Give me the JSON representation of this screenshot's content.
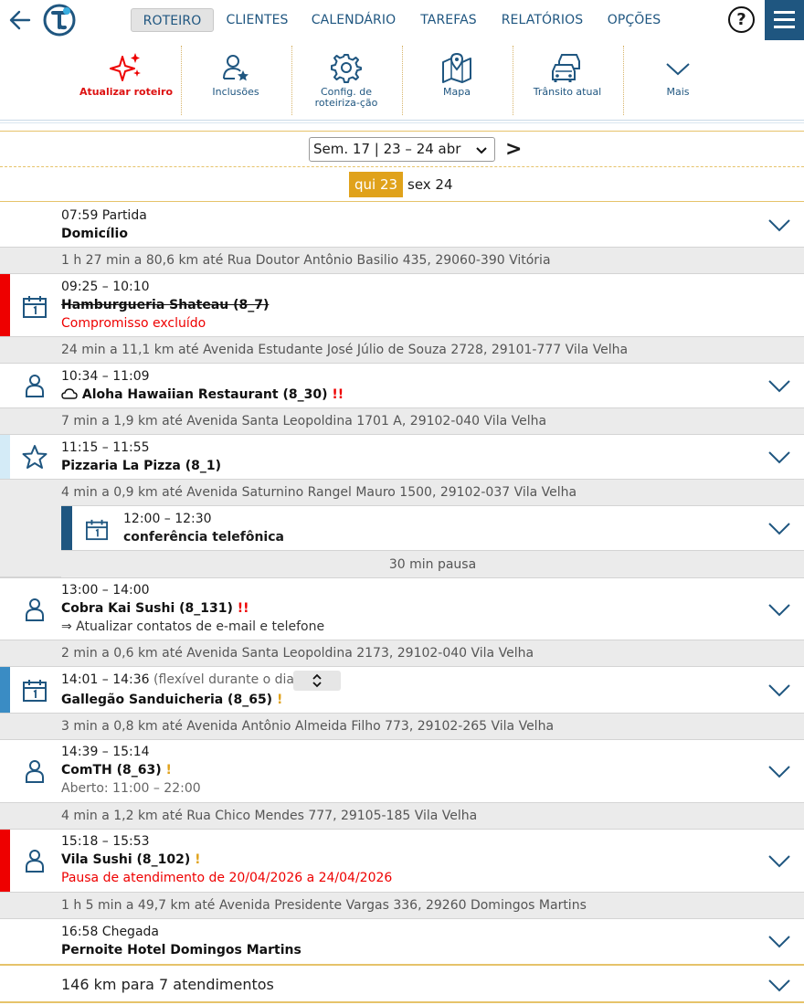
{
  "nav": {
    "tabs": [
      "ROTEIRO",
      "CLIENTES",
      "CALENDÁRIO",
      "TAREFAS",
      "RELATÓRIOS",
      "OPÇÕES"
    ],
    "active_tab": "ROTEIRO",
    "help_label": "?"
  },
  "toolbar": {
    "update_route": "Atualizar roteiro",
    "inclusions": "Inclusões",
    "routing_config": "Config. de roteiriza-ção",
    "map": "Mapa",
    "traffic": "Trânsito atual",
    "more": "Mais"
  },
  "week": {
    "selected": "Sem. 17 | 23 – 24 abr",
    "next_label": ">",
    "days": [
      "qui 23",
      "sex 24"
    ],
    "active_day": "qui 23"
  },
  "route": {
    "start": {
      "time": "07:59 Partida",
      "name": "Domicílio"
    },
    "travel1": "1 h 27 min a 80,6 km até Rua Doutor Antônio Basilio 435, 29060-390 Vitória",
    "stop1": {
      "time": "09:25 – 10:10",
      "name": "Hamburgueria Shateau (8_7)",
      "note": "Compromisso excluído"
    },
    "travel2": "24 min a 11,1 km até Avenida Estudante José Júlio de Souza 2728, 29101-777 Vila Velha",
    "stop2": {
      "time": "10:34 – 11:09",
      "name": "Aloha Hawaiian Restaurant (8_30)",
      "flag": "!!"
    },
    "travel3": "7 min a 1,9 km até Avenida Santa Leopoldina 1701 A, 29102-040 Vila Velha",
    "stop3": {
      "time": "11:15 – 11:55",
      "name": "Pizzaria La Pizza (8_1)"
    },
    "travel4": "4 min a 0,9 km até Avenida Saturnino Rangel Mauro 1500, 29102-037 Vila Velha",
    "appointment": {
      "time": "12:00 – 12:30",
      "name": "conferência telefônica"
    },
    "pause": "30 min pausa",
    "stop4": {
      "time": "13:00 – 14:00",
      "name": "Cobra Kai Sushi (8_131)",
      "flag": "!!",
      "note": "⇒ Atualizar contatos de e-mail e telefone"
    },
    "travel5": "2 min a 0,6 km até Avenida Santa Leopoldina 2173, 29102-040 Vila Velha",
    "stop5": {
      "time": "14:01 – 14:36",
      "flex": "(flexível durante o dia)",
      "name": "Gallegão Sanduicheria (8_65)",
      "flag": "!"
    },
    "travel6": "3 min a 0,8 km até Avenida Antônio Almeida Filho 773, 29102-265 Vila Velha",
    "stop6": {
      "time": "14:39 – 15:14",
      "name": "ComTH (8_63)",
      "flag": "!",
      "note": "Aberto: 11:00 – 22:00"
    },
    "travel7": "4 min a 1,2 km até Rua Chico Mendes 777, 29105-185 Vila Velha",
    "stop7": {
      "time": "15:18 – 15:53",
      "name": "Vila Sushi (8_102)",
      "flag": "!",
      "note": "Pausa de atendimento de 20/04/2026 a 24/04/2026"
    },
    "travel8": "1 h 5 min a 49,7 km até Avenida Presidente Vargas 336, 29260 Domingos Martins",
    "end": {
      "time": "16:58 Chegada",
      "name": "Pernoite Hotel Domingos Martins"
    },
    "summary": "146 km para 7 atendimentos"
  },
  "colors": {
    "brand": "#1f5680",
    "accent": "#e0a21b",
    "alert_red": "#ee0000",
    "stripe_light_blue": "#d4ebf7",
    "stripe_mid_blue": "#3a8cc4"
  },
  "icons": {
    "back": "arrow-left-icon",
    "logo": "t-logo-icon",
    "menu": "hamburger-icon",
    "update": "sparkle-icon",
    "inclusions": "person-star-icon",
    "config": "gear-icon",
    "map": "map-pin-icon",
    "traffic": "traffic-cars-icon",
    "more": "chevron-down-icon",
    "calendar": "calendar-icon",
    "person": "person-icon",
    "star": "star-icon",
    "cloud": "cloud-icon"
  }
}
